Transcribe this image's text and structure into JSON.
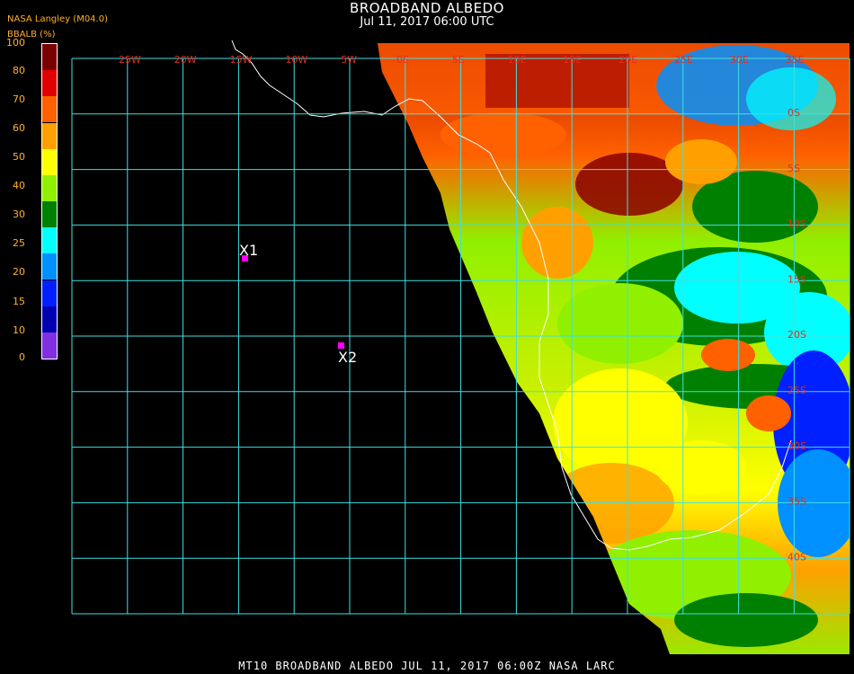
{
  "header": {
    "title": "BROADBAND ALBEDO",
    "datetime": "Jul 11, 2017 06:00 UTC",
    "source": "NASA Langley (M04.0)",
    "unit_label": "BBALB (%)"
  },
  "legend": {
    "ticks": [
      "100",
      "80",
      "70",
      "60",
      "50",
      "40",
      "30",
      "25",
      "20",
      "15",
      "10",
      "0"
    ],
    "colors": [
      "#7a0000",
      "#e00000",
      "#ff6000",
      "#ffa000",
      "#ffff00",
      "#90f000",
      "#008000",
      "#00ffff",
      "#0090ff",
      "#0020ff",
      "#0000b0",
      "#8030e0"
    ]
  },
  "map": {
    "lon_labels": [
      "25W",
      "20W",
      "15W",
      "10W",
      "5W",
      "0E",
      "5E",
      "10E",
      "15E",
      "20E",
      "25E",
      "30E",
      "35E"
    ],
    "lat_labels": [
      "0S",
      "5S",
      "10S",
      "15S",
      "20S",
      "25S",
      "30S",
      "35S",
      "40S"
    ],
    "markers": [
      {
        "id": "X1",
        "label": "X1"
      },
      {
        "id": "X2",
        "label": "X2"
      }
    ],
    "colors": {
      "grid": "#40e0e0",
      "coast": "#ffffff",
      "marker": "#ff00ff",
      "ocean": "#000000"
    }
  },
  "footer": {
    "text": "MT10  BROADBAND ALBEDO   JUL 11, 2017 06:00Z   NASA LARC"
  }
}
